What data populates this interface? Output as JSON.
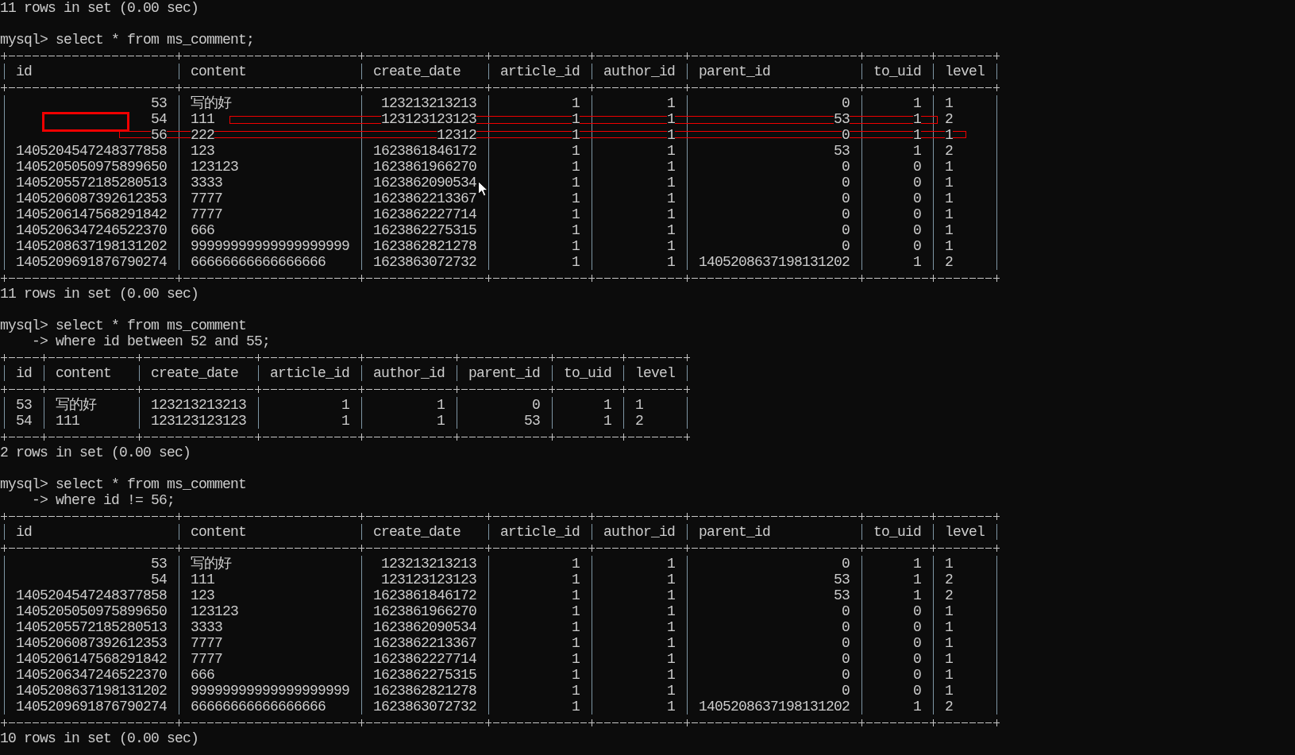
{
  "console": {
    "previous_output": "11 rows in set (0.00 sec)",
    "queries": [
      {
        "prompt": "mysql>",
        "command_lines": [
          "select * from ms_comment;"
        ],
        "result": {
          "columns": [
            {
              "name": "id",
              "kind": "number"
            },
            {
              "name": "content",
              "kind": "text"
            },
            {
              "name": "create_date",
              "kind": "number"
            },
            {
              "name": "article_id",
              "kind": "number"
            },
            {
              "name": "author_id",
              "kind": "number"
            },
            {
              "name": "parent_id",
              "kind": "number"
            },
            {
              "name": "to_uid",
              "kind": "number"
            },
            {
              "name": "level",
              "kind": "text"
            }
          ],
          "rows": [
            [
              "53",
              "写的好",
              "123213213213",
              "1",
              "1",
              "0",
              "1",
              "1"
            ],
            [
              "54",
              "111",
              "123123123123",
              "1",
              "1",
              "53",
              "1",
              "2"
            ],
            [
              "56",
              "222",
              "12312",
              "1",
              "1",
              "0",
              "1",
              "1"
            ],
            [
              "1405204547248377858",
              "123",
              "1623861846172",
              "1",
              "1",
              "53",
              "1",
              "2"
            ],
            [
              "1405205050975899650",
              "123123",
              "1623861966270",
              "1",
              "1",
              "0",
              "0",
              "1"
            ],
            [
              "1405205572185280513",
              "3333",
              "1623862090534",
              "1",
              "1",
              "0",
              "0",
              "1"
            ],
            [
              "1405206087392612353",
              "7777",
              "1623862213367",
              "1",
              "1",
              "0",
              "0",
              "1"
            ],
            [
              "1405206147568291842",
              "7777",
              "1623862227714",
              "1",
              "1",
              "0",
              "0",
              "1"
            ],
            [
              "1405206347246522370",
              "666",
              "1623862275315",
              "1",
              "1",
              "0",
              "0",
              "1"
            ],
            [
              "1405208637198131202",
              "99999999999999999999",
              "1623862821278",
              "1",
              "1",
              "0",
              "0",
              "1"
            ],
            [
              "1405209691876790274",
              "66666666666666666",
              "1623863072732",
              "1",
              "1",
              "1405208637198131202",
              "1",
              "2"
            ]
          ],
          "annotations": [
            {
              "kind": "thick_box"
            },
            {
              "kind": "thin_box"
            },
            {
              "kind": "thin_box"
            }
          ],
          "summary": "11 rows in set (0.00 sec)"
        }
      },
      {
        "prompt": "mysql>",
        "continuation_prompt": "->",
        "command_lines": [
          "select * from ms_comment",
          "where id between 52 and 55;"
        ],
        "result": {
          "columns": [
            {
              "name": "id",
              "kind": "number"
            },
            {
              "name": "content",
              "kind": "text"
            },
            {
              "name": "create_date",
              "kind": "number"
            },
            {
              "name": "article_id",
              "kind": "number"
            },
            {
              "name": "author_id",
              "kind": "number"
            },
            {
              "name": "parent_id",
              "kind": "number"
            },
            {
              "name": "to_uid",
              "kind": "number"
            },
            {
              "name": "level",
              "kind": "text"
            }
          ],
          "rows": [
            [
              "53",
              "写的好",
              "123213213213",
              "1",
              "1",
              "0",
              "1",
              "1"
            ],
            [
              "54",
              "111",
              "123123123123",
              "1",
              "1",
              "53",
              "1",
              "2"
            ]
          ],
          "summary": "2 rows in set (0.00 sec)"
        }
      },
      {
        "prompt": "mysql>",
        "continuation_prompt": "->",
        "command_lines": [
          "select * from ms_comment",
          "where id != 56;"
        ],
        "result": {
          "columns": [
            {
              "name": "id",
              "kind": "number"
            },
            {
              "name": "content",
              "kind": "text"
            },
            {
              "name": "create_date",
              "kind": "number"
            },
            {
              "name": "article_id",
              "kind": "number"
            },
            {
              "name": "author_id",
              "kind": "number"
            },
            {
              "name": "parent_id",
              "kind": "number"
            },
            {
              "name": "to_uid",
              "kind": "number"
            },
            {
              "name": "level",
              "kind": "text"
            }
          ],
          "rows": [
            [
              "53",
              "写的好",
              "123213213213",
              "1",
              "1",
              "0",
              "1",
              "1"
            ],
            [
              "54",
              "111",
              "123123123123",
              "1",
              "1",
              "53",
              "1",
              "2"
            ],
            [
              "1405204547248377858",
              "123",
              "1623861846172",
              "1",
              "1",
              "53",
              "1",
              "2"
            ],
            [
              "1405205050975899650",
              "123123",
              "1623861966270",
              "1",
              "1",
              "0",
              "0",
              "1"
            ],
            [
              "1405205572185280513",
              "3333",
              "1623862090534",
              "1",
              "1",
              "0",
              "0",
              "1"
            ],
            [
              "1405206087392612353",
              "7777",
              "1623862213367",
              "1",
              "1",
              "0",
              "0",
              "1"
            ],
            [
              "1405206147568291842",
              "7777",
              "1623862227714",
              "1",
              "1",
              "0",
              "0",
              "1"
            ],
            [
              "1405206347246522370",
              "666",
              "1623862275315",
              "1",
              "1",
              "0",
              "0",
              "1"
            ],
            [
              "1405208637198131202",
              "99999999999999999999",
              "1623862821278",
              "1",
              "1",
              "0",
              "0",
              "1"
            ],
            [
              "1405209691876790274",
              "66666666666666666",
              "1623863072732",
              "1",
              "1",
              "1405208637198131202",
              "1",
              "2"
            ]
          ],
          "summary": "10 rows in set (0.00 sec)"
        }
      }
    ]
  }
}
